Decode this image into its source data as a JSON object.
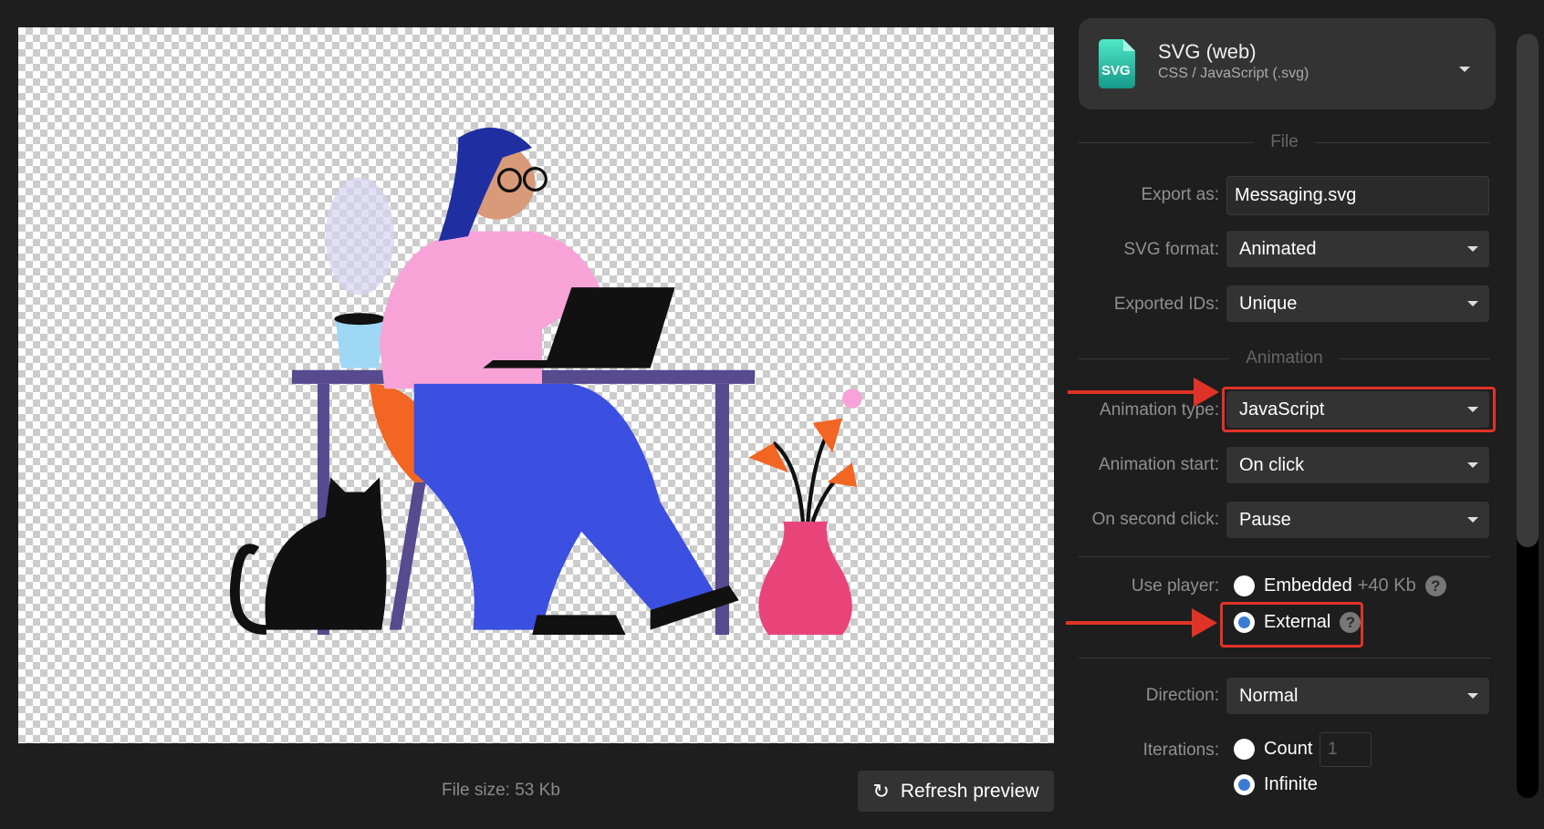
{
  "preview": {
    "file_size": "File size: 53 Kb",
    "refresh_label": "Refresh preview"
  },
  "format": {
    "icon_label": "SVG",
    "title": "SVG (web)",
    "subtitle": "CSS / JavaScript (.svg)"
  },
  "sections": {
    "file": "File",
    "animation": "Animation"
  },
  "fields": {
    "export_as": {
      "label": "Export as:",
      "value": "Messaging.svg"
    },
    "svg_format": {
      "label": "SVG format:",
      "value": "Animated"
    },
    "exported_ids": {
      "label": "Exported IDs:",
      "value": "Unique"
    },
    "animation_type": {
      "label": "Animation type:",
      "value": "JavaScript"
    },
    "animation_start": {
      "label": "Animation start:",
      "value": "On click"
    },
    "on_second_click": {
      "label": "On second click:",
      "value": "Pause"
    },
    "use_player": {
      "label": "Use player:",
      "options": [
        {
          "label": "Embedded",
          "extra": "+40 Kb",
          "selected": false
        },
        {
          "label": "External",
          "selected": true
        }
      ]
    },
    "direction": {
      "label": "Direction:",
      "value": "Normal"
    },
    "iterations": {
      "label": "Iterations:",
      "options": [
        {
          "label": "Count",
          "selected": false
        },
        {
          "label": "Infinite",
          "selected": true
        }
      ],
      "count_placeholder": "1"
    }
  },
  "colors": {
    "accent": "#3a7bd5",
    "highlight": "#e03327",
    "icon": "#1fb5a0"
  }
}
